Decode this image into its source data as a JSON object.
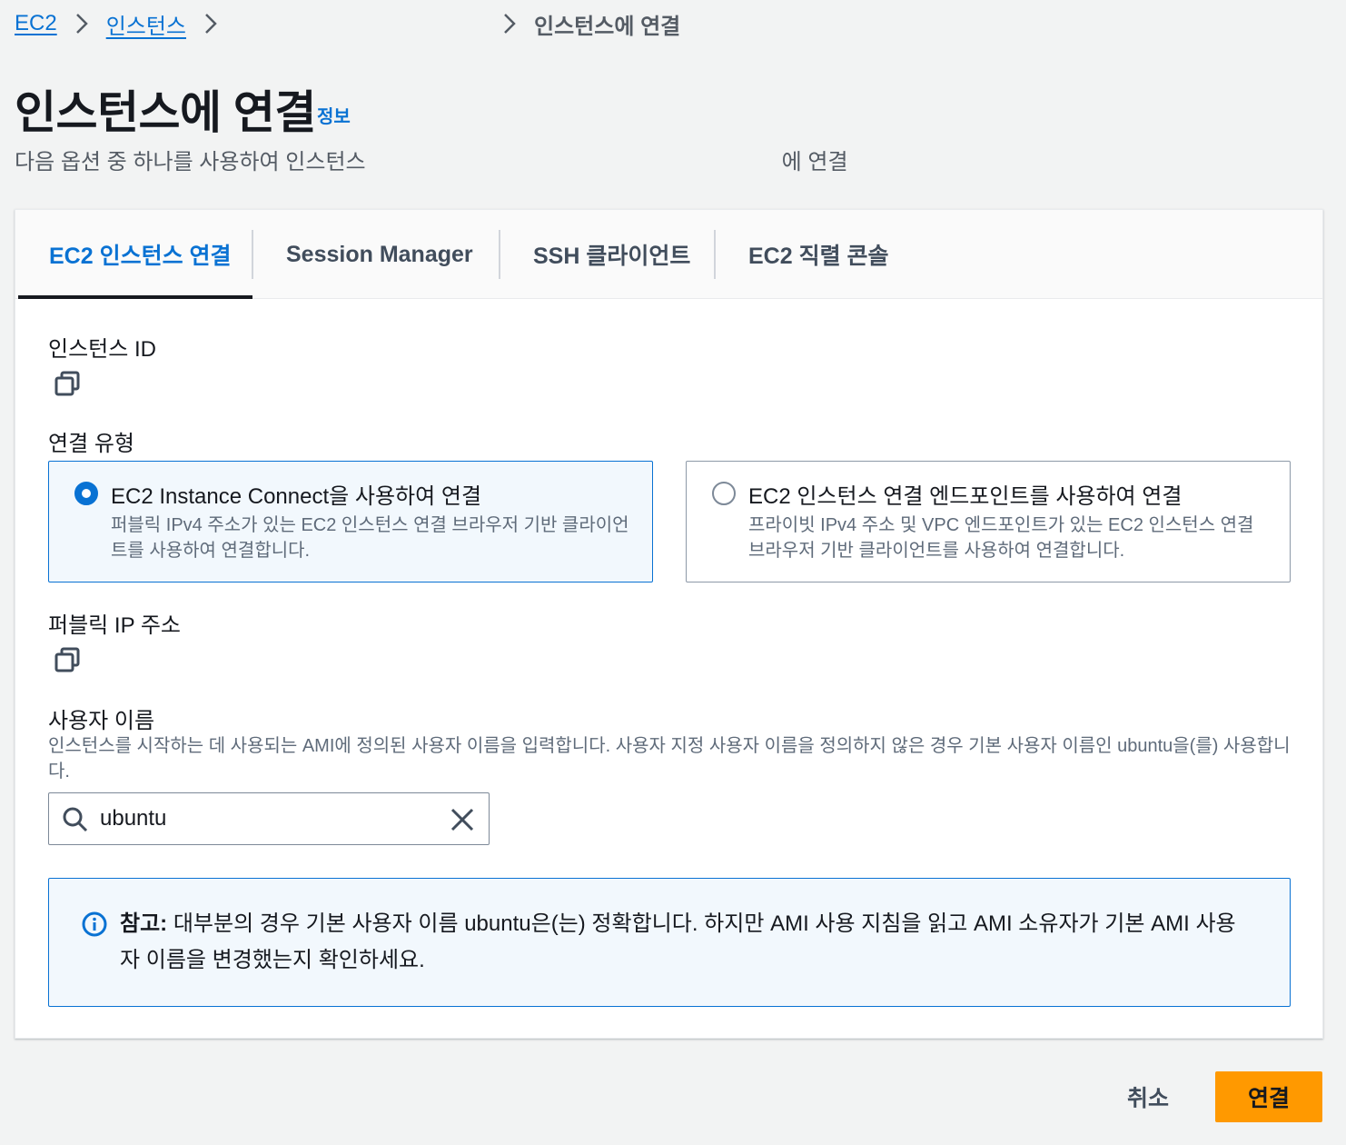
{
  "breadcrumb": {
    "items": [
      "EC2",
      "인스턴스"
    ],
    "current": "인스턴스에 연결"
  },
  "header": {
    "title": "인스턴스에 연결",
    "info": "정보",
    "subtitle_prefix": "다음 옵션 중 하나를 사용하여 인스턴스",
    "subtitle_suffix": "에 연결"
  },
  "tabs": [
    {
      "label": "EC2 인스턴스 연결",
      "active": true
    },
    {
      "label": "Session Manager",
      "active": false
    },
    {
      "label": "SSH 클라이언트",
      "active": false
    },
    {
      "label": "EC2 직렬 콘솔",
      "active": false
    }
  ],
  "form": {
    "instance_id_label": "인스턴스 ID",
    "connection_type_label": "연결 유형",
    "options": [
      {
        "title": "EC2 Instance Connect을 사용하여 연결",
        "desc": "퍼블릭 IPv4 주소가 있는 EC2 인스턴스 연결 브라우저 기반 클라이언트를 사용하여 연결합니다.",
        "selected": true
      },
      {
        "title": "EC2 인스턴스 연결 엔드포인트를 사용하여 연결",
        "desc": "프라이빗 IPv4 주소 및 VPC 엔드포인트가 있는 EC2 인스턴스 연결 브라우저 기반 클라이언트를 사용하여 연결합니다.",
        "selected": false
      }
    ],
    "public_ip_label": "퍼블릭 IP 주소",
    "username_label": "사용자 이름",
    "username_helper": "인스턴스를 시작하는 데 사용되는 AMI에 정의된 사용자 이름을 입력합니다. 사용자 지정 사용자 이름을 정의하지 않은 경우 기본 사용자 이름인 ubuntu을(를) 사용합니다.",
    "username_value": "ubuntu"
  },
  "alert": {
    "prefix": "참고:",
    "text": " 대부분의 경우 기본 사용자 이름 ubuntu은(는) 정확합니다. 하지만 AMI 사용 지침을 읽고 AMI 소유자가 기본 AMI 사용자 이름을 변경했는지 확인하세요."
  },
  "footer": {
    "cancel": "취소",
    "connect": "연결"
  },
  "colors": {
    "accent": "#0972d3",
    "primary_button": "#ff9900"
  }
}
